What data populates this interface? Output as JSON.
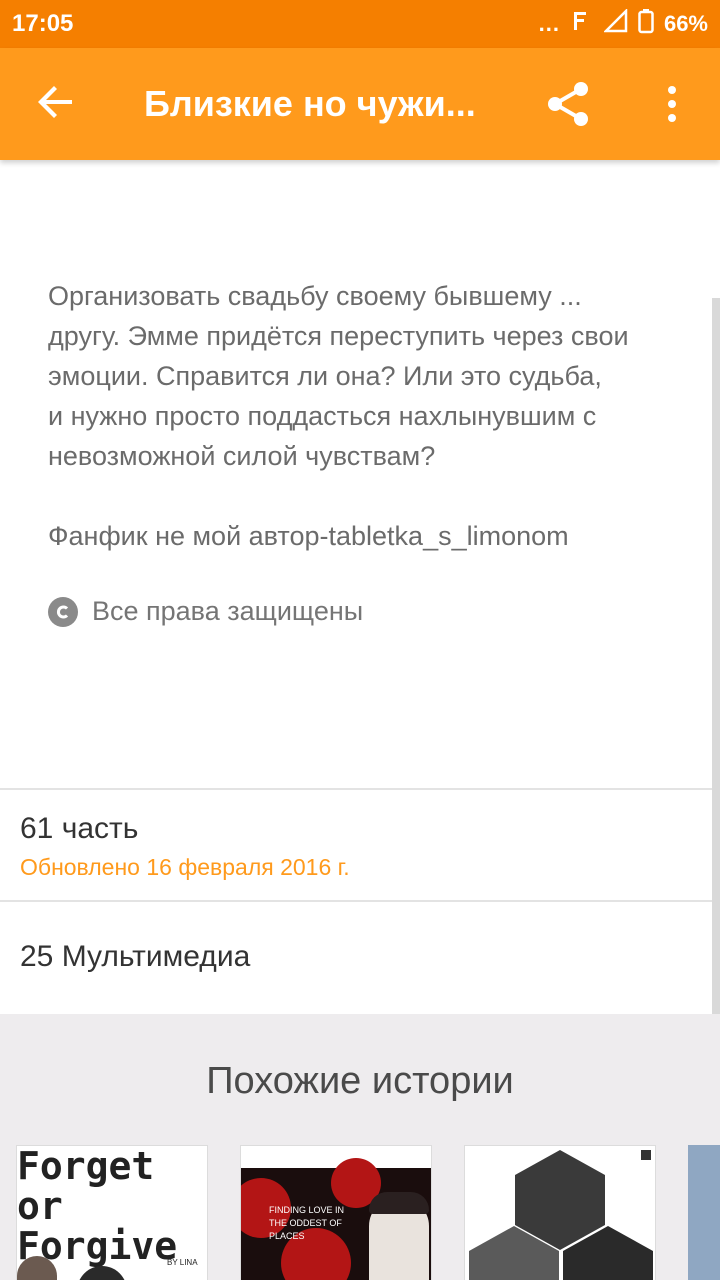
{
  "status_bar": {
    "time": "17:05",
    "notif_dots": "...",
    "battery": "66%"
  },
  "app_bar": {
    "title": "Близкие но чужи...",
    "back_icon": "arrow-back-icon",
    "share_icon": "share-icon",
    "more_icon": "more-vert-icon"
  },
  "story": {
    "description_lines": [
      "Организовать свадьбу своему бывшему ...",
      "другу. Эмме придётся переступить через свои",
      "эмоции. Справится ли она? Или это судьба,",
      "и нужно просто поддасться нахлынувшим с",
      "невозможной силой чувствам?",
      "Фанфик не мой автор-tabletka_s_limonom"
    ],
    "copyright": "Все права защищены"
  },
  "parts": {
    "count": "61 часть",
    "updated": "Обновлено 16 февраля 2016 г."
  },
  "media": {
    "label": "25 Мультимедиа"
  },
  "similar": {
    "title": "Похожие истории",
    "cover1_text": "Forget or Forgive",
    "cover1_author": "BY LINA",
    "cover2_text": "FINDING LOVE IN THE ODDEST OF PLACES"
  },
  "colors": {
    "status_bar": "#f57f00",
    "app_bar": "#ff9a1c",
    "accent_text": "#ff9a1c"
  }
}
